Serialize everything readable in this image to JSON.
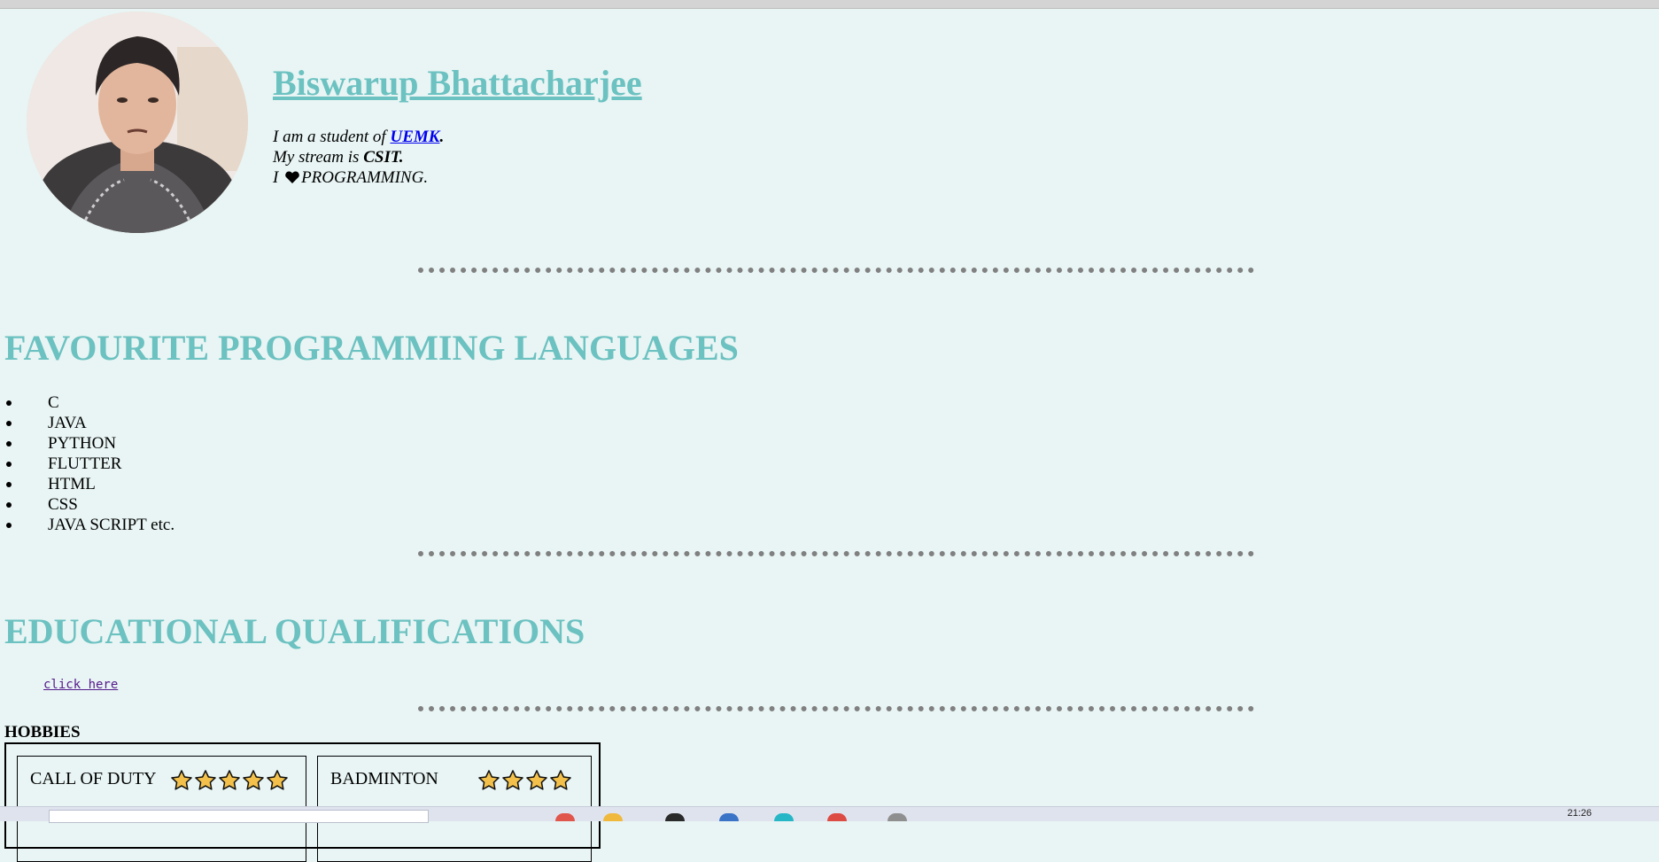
{
  "profile": {
    "name": "Biswarup Bhattacharjee",
    "intro": {
      "line1_prefix": "I am a student of ",
      "college": "UEMK",
      "line1_suffix": ".",
      "line2_prefix": "My stream is ",
      "stream": "CSIT.",
      "line3_prefix": "I ",
      "line3_suffix": "PROGRAMMING."
    }
  },
  "sections": {
    "languages_title": "FAVOURITE PROGRAMMING LANGUAGES",
    "education_title": "EDUCATIONAL QUALIFICATIONS",
    "hobbies_title": "HOBBIES"
  },
  "languages": [
    "C",
    "JAVA",
    "PYTHON",
    "FLUTTER",
    "HTML",
    "CSS",
    "JAVA SCRIPT etc."
  ],
  "education": {
    "link_label": "click here"
  },
  "hobbies": [
    {
      "label": "CALL OF DUTY",
      "rating": 5
    },
    {
      "label": "BADMINTON",
      "rating": 4
    }
  ],
  "taskbar": {
    "clock": "21:26"
  },
  "colors": {
    "background": "#e8f5f4",
    "accent": "#6cc1c1",
    "divider": "#808080",
    "star_fill": "#f3c14b"
  },
  "icons": [
    "heart-icon",
    "star-icon"
  ]
}
